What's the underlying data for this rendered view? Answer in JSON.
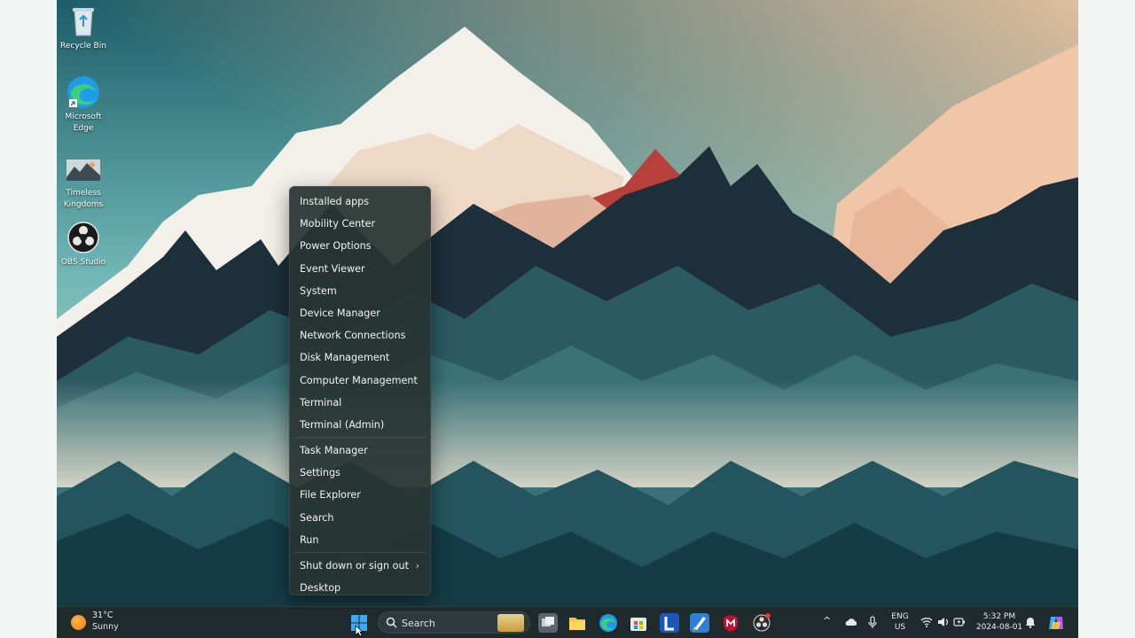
{
  "desktop": {
    "icons": [
      {
        "label": "Recycle Bin",
        "icon": "recycle-bin-icon"
      },
      {
        "label": "Microsoft Edge",
        "icon": "edge-icon"
      },
      {
        "label": "Timeless Kingdoms",
        "icon": "game-icon"
      },
      {
        "label": "OBS Studio",
        "icon": "obs-icon"
      }
    ]
  },
  "context_menu": {
    "groups": [
      [
        "Installed apps",
        "Mobility Center",
        "Power Options",
        "Event Viewer",
        "System",
        "Device Manager",
        "Network Connections",
        "Disk Management",
        "Computer Management",
        "Terminal",
        "Terminal (Admin)"
      ],
      [
        "Task Manager",
        "Settings",
        "File Explorer",
        "Search",
        "Run"
      ],
      [
        "Shut down or sign out",
        "Desktop"
      ]
    ],
    "submenu_arrow": "›"
  },
  "taskbar": {
    "weather": {
      "temp": "31°C",
      "condition": "Sunny"
    },
    "search": {
      "placeholder": "Search"
    },
    "pinned": [
      "start-icon",
      "task-view-icon",
      "file-explorer-icon",
      "edge-icon",
      "store-icon",
      "l-app-icon",
      "drawing-app-icon",
      "mcafee-icon",
      "obs-icon"
    ],
    "tray": {
      "chevron": "^",
      "lang_top": "ENG",
      "lang_bottom": "US",
      "time": "5:32 PM",
      "date": "2024-08-01"
    }
  },
  "colors": {
    "accent": "#0078d4",
    "menu_bg": "#28343280",
    "taskbar_bg": "#1f2a2d"
  }
}
